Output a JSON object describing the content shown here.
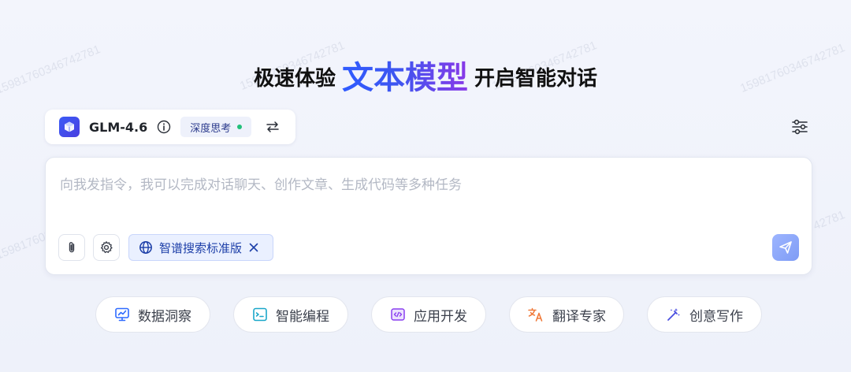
{
  "watermark": "15981760346742781",
  "headline": {
    "prefix": "极速体验",
    "highlight": "文本模型",
    "suffix": "开启智能对话"
  },
  "model_bar": {
    "model_name": "GLM-4.6",
    "deep_think_label": "深度思考"
  },
  "composer": {
    "placeholder": "向我发指令，我可以完成对话聊天、创作文章、生成代码等多种任务",
    "search_chip_label": "智谱搜索标准版"
  },
  "quick_actions": [
    {
      "label": "数据洞察",
      "icon": "chart-monitor-icon",
      "color": "#2f6bff"
    },
    {
      "label": "智能编程",
      "icon": "terminal-icon",
      "color": "#1aa7c9"
    },
    {
      "label": "应用开发",
      "icon": "code-window-icon",
      "color": "#8a3ff0"
    },
    {
      "label": "翻译专家",
      "icon": "translate-icon",
      "color": "#f07a3a"
    },
    {
      "label": "创意写作",
      "icon": "magic-wand-icon",
      "color": "#4a4fe0"
    }
  ],
  "colors": {
    "accent": "#3e55f0",
    "accent_purple": "#8a39e8",
    "status_green": "#22c07a",
    "send_button": "#8ea8f8"
  }
}
